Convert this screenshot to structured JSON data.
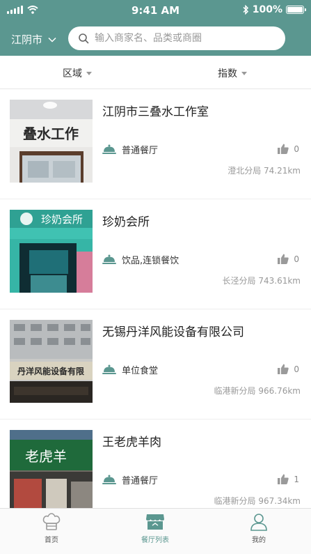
{
  "status_bar": {
    "time": "9:41 AM",
    "battery": "100%"
  },
  "header": {
    "city": "江阴市",
    "search_placeholder": "输入商家名、品类或商圈"
  },
  "filters": {
    "region": "区域",
    "index": "指数"
  },
  "restaurants": [
    {
      "name": "江阴市三叠水工作室",
      "category": "普通餐厅",
      "likes": "0",
      "location": "澄北分局 74.21km",
      "sign_text": "叠水工作"
    },
    {
      "name": "珍奶会所",
      "category": "饮品,连锁餐饮",
      "likes": "0",
      "location": "长泾分局 743.61km",
      "sign_text": "珍奶会所"
    },
    {
      "name": "无锡丹洋风能设备有限公司",
      "category": "单位食堂",
      "likes": "0",
      "location": "临港新分局 966.76km",
      "sign_text": "丹洋风能设备有限"
    },
    {
      "name": "王老虎羊肉",
      "category": "普通餐厅",
      "likes": "1",
      "location": "临港新分局 967.34km",
      "sign_text": "老虎羊"
    }
  ],
  "tabbar": {
    "home": "首页",
    "list": "餐厅列表",
    "mine": "我的"
  },
  "colors": {
    "theme": "#5b9790",
    "icon_gray": "#9a9a9a"
  }
}
